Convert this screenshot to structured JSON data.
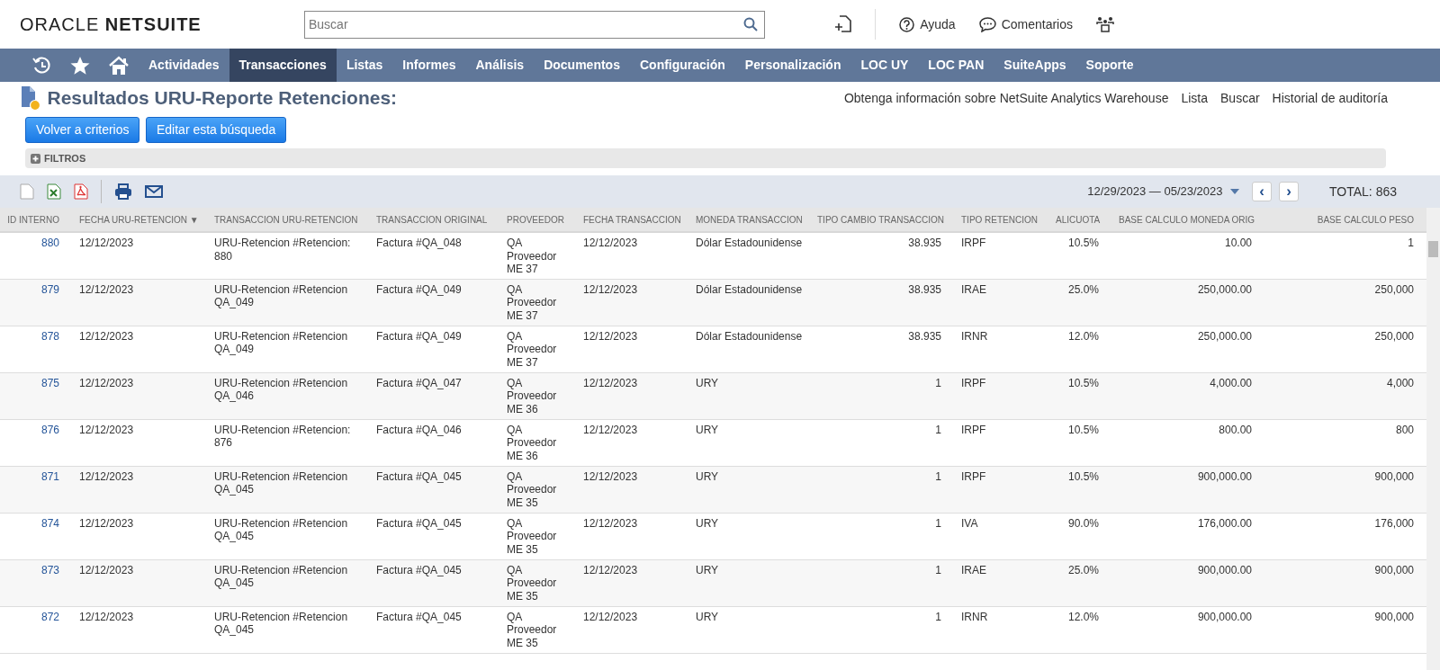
{
  "header": {
    "logo_left": "ORACLE",
    "logo_right": "NETSUITE",
    "search": {
      "placeholder": "Buscar"
    },
    "links": [
      "Ayuda",
      "Comentarios"
    ]
  },
  "nav": {
    "items": [
      {
        "label": "Actividades",
        "selected": false
      },
      {
        "label": "Transacciones",
        "selected": true
      },
      {
        "label": "Listas",
        "selected": false
      },
      {
        "label": "Informes",
        "selected": false
      },
      {
        "label": "Análisis",
        "selected": false
      },
      {
        "label": "Documentos",
        "selected": false
      },
      {
        "label": "Configuración",
        "selected": false
      },
      {
        "label": "Personalización",
        "selected": false
      },
      {
        "label": "LOC UY",
        "selected": false
      },
      {
        "label": "LOC PAN",
        "selected": false
      },
      {
        "label": "SuiteApps",
        "selected": false
      },
      {
        "label": "Soporte",
        "selected": false
      }
    ]
  },
  "page": {
    "title": "Resultados URU-Reporte Retenciones:",
    "links": [
      "Obtenga información sobre NetSuite Analytics Warehouse",
      "Lista",
      "Buscar",
      "Historial de auditoría"
    ],
    "buttons": [
      "Volver a criterios",
      "Editar esta búsqueda"
    ],
    "filters_label": "FILTROS",
    "filters_expanded": false
  },
  "toolbar": {
    "date_range": "12/29/2023 — 05/23/2023",
    "prev": "‹",
    "next": "›",
    "total": "TOTAL: 863"
  },
  "table": {
    "columns": [
      {
        "label": "ID INTERNO",
        "kind": "link"
      },
      {
        "label": "FECHA URU-RETENCION",
        "kind": "text",
        "sort": "▼"
      },
      {
        "label": "TRANSACCION URU-RETENCION",
        "kind": "text"
      },
      {
        "label": "TRANSACCION ORIGINAL",
        "kind": "text"
      },
      {
        "label": "PROVEEDOR",
        "kind": "text"
      },
      {
        "label": "FECHA TRANSACCION",
        "kind": "text"
      },
      {
        "label": "MONEDA TRANSACCION",
        "kind": "text"
      },
      {
        "label": "TIPO CAMBIO TRANSACCION",
        "kind": "number"
      },
      {
        "label": "TIPO RETENCION",
        "kind": "text"
      },
      {
        "label": "ALICUOTA",
        "kind": "number"
      },
      {
        "label": "BASE CALCULO MONEDA ORIG",
        "kind": "number"
      },
      {
        "label": "BASE CALCULO PESO",
        "kind": "number"
      }
    ],
    "rows": [
      [
        "880",
        "12/12/2023",
        "URU-Retencion #Retencion: 880",
        "Factura #QA_048",
        "QA Proveedor ME 37",
        "12/12/2023",
        "Dólar Estadounidense",
        "38.935",
        "IRPF",
        "10.5%",
        "10.00",
        "1"
      ],
      [
        "879",
        "12/12/2023",
        "URU-Retencion #Retencion QA_049",
        "Factura #QA_049",
        "QA Proveedor ME 37",
        "12/12/2023",
        "Dólar Estadounidense",
        "38.935",
        "IRAE",
        "25.0%",
        "250,000.00",
        "250,000"
      ],
      [
        "878",
        "12/12/2023",
        "URU-Retencion #Retencion QA_049",
        "Factura #QA_049",
        "QA Proveedor ME 37",
        "12/12/2023",
        "Dólar Estadounidense",
        "38.935",
        "IRNR",
        "12.0%",
        "250,000.00",
        "250,000"
      ],
      [
        "875",
        "12/12/2023",
        "URU-Retencion #Retencion QA_046",
        "Factura #QA_047",
        "QA Proveedor ME 36",
        "12/12/2023",
        "URY",
        "1",
        "IRPF",
        "10.5%",
        "4,000.00",
        "4,000"
      ],
      [
        "876",
        "12/12/2023",
        "URU-Retencion #Retencion: 876",
        "Factura #QA_046",
        "QA Proveedor ME 36",
        "12/12/2023",
        "URY",
        "1",
        "IRPF",
        "10.5%",
        "800.00",
        "800"
      ],
      [
        "871",
        "12/12/2023",
        "URU-Retencion #Retencion QA_045",
        "Factura #QA_045",
        "QA Proveedor ME 35",
        "12/12/2023",
        "URY",
        "1",
        "IRPF",
        "10.5%",
        "900,000.00",
        "900,000"
      ],
      [
        "874",
        "12/12/2023",
        "URU-Retencion #Retencion QA_045",
        "Factura #QA_045",
        "QA Proveedor ME 35",
        "12/12/2023",
        "URY",
        "1",
        "IVA",
        "90.0%",
        "176,000.00",
        "176,000"
      ],
      [
        "873",
        "12/12/2023",
        "URU-Retencion #Retencion QA_045",
        "Factura #QA_045",
        "QA Proveedor ME 35",
        "12/12/2023",
        "URY",
        "1",
        "IRAE",
        "25.0%",
        "900,000.00",
        "900,000"
      ],
      [
        "872",
        "12/12/2023",
        "URU-Retencion #Retencion QA_045",
        "Factura #QA_045",
        "QA Proveedor ME 35",
        "12/12/2023",
        "URY",
        "1",
        "IRNR",
        "12.0%",
        "900,000.00",
        "900,000"
      ]
    ]
  }
}
